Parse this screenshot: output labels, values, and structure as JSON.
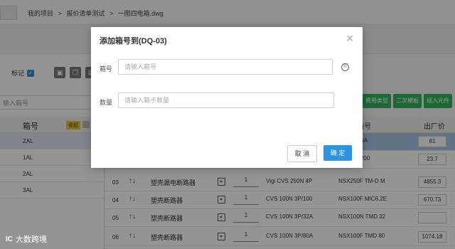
{
  "breadcrumb": [
    "我的项目",
    ">",
    "报价清单测试",
    ">",
    "一图四电箱.dwg"
  ],
  "left": {
    "mark_label": "标记",
    "search_placeholder": "输入箱号",
    "header_col2": "箱号",
    "header_tag": "收起",
    "rows": [
      "ZAL",
      "1AL",
      "2AL",
      "3AL"
    ]
  },
  "right_buttons": [
    "费用类型",
    "二次模板",
    "插入元件"
  ],
  "table": {
    "header_box": "箱号",
    "header_price": "出厂价",
    "rows": [
      {
        "idx": "",
        "name": "",
        "qty": "",
        "spec": "",
        "model": "S-4 1.5(6)A",
        "price": "81"
      },
      {
        "idx": "",
        "name": "",
        "qty": "",
        "spec": "",
        "model": "66 Φ30I 200",
        "price": "23.7"
      },
      {
        "idx": "03",
        "name": "塑壳漏电断路器",
        "qty": "1",
        "spec": "Vigi CVS 250N 4P",
        "model": "NSX250F TM-D M",
        "price": "4855.3"
      },
      {
        "idx": "04",
        "name": "塑壳断路器",
        "qty": "1",
        "spec": "CVS 100N 3P/100",
        "model": "NSX100F MIC6.2E",
        "price": "670.73"
      },
      {
        "idx": "05",
        "name": "塑壳断路器",
        "qty": "1",
        "spec": "CVS 100N 3P/32A",
        "model": "NSX100N TMD 32",
        "price": ""
      },
      {
        "idx": "06",
        "name": "塑壳断路器",
        "qty": "1",
        "spec": "CVS 100N 3P/80A",
        "model": "NSX100F TMD 80",
        "price": "1074.18"
      }
    ]
  },
  "modal": {
    "title": "添加箱号到(DQ-03)",
    "label_box": "箱号",
    "placeholder_box": "请输入箱号",
    "label_qty": "数量",
    "placeholder_qty": "请输入箱子数量",
    "cancel": "取 消",
    "ok": "确 定"
  },
  "watermark": {
    "logo": "IC",
    "text": "大数跨境"
  }
}
